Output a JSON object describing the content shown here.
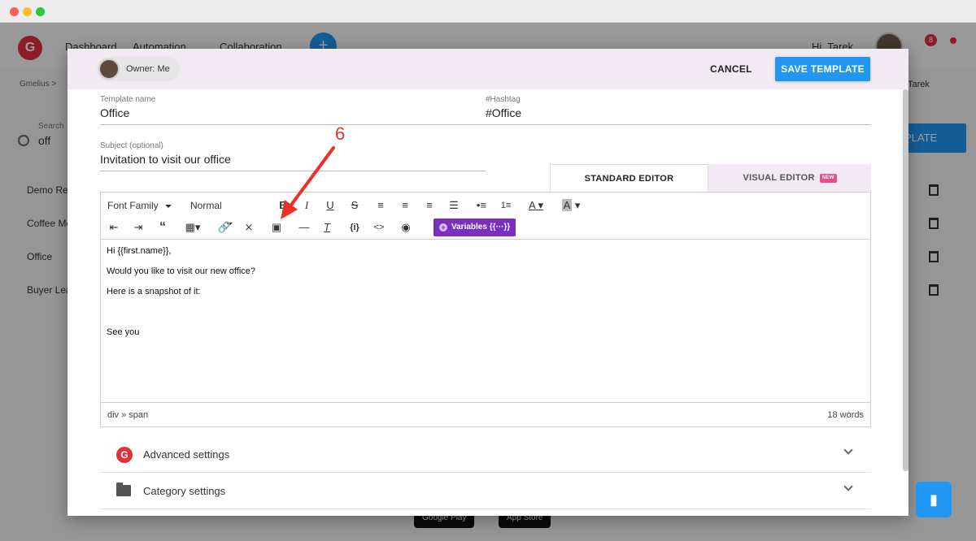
{
  "background": {
    "nav": [
      "Dashboard",
      "Automation",
      "Collaboration"
    ],
    "plus_label": "+",
    "greeting": "Hi, Tarek",
    "badge_count": "8",
    "breadcrumb": "Gmelius >",
    "user_label": "p, Tarek",
    "search_label": "Search",
    "search_value": "off",
    "create_label": "PLATE",
    "rows": [
      "Demo Rec",
      "Coffee Me",
      "Office",
      "Buyer Lea"
    ],
    "stores": [
      "Google Play",
      "App Store"
    ]
  },
  "modal": {
    "owner_label": "Owner: Me",
    "cancel_label": "CANCEL",
    "save_label": "SAVE TEMPLATE",
    "template_name": {
      "label": "Template name",
      "value": "Office"
    },
    "hashtag": {
      "label": "#Hashtag",
      "value": "#Office"
    },
    "subject": {
      "label": "Subject (optional)",
      "value": "Invitation to visit our office"
    },
    "tabs": {
      "standard": "STANDARD EDITOR",
      "visual": "VISUAL EDITOR",
      "new_badge": "NEW"
    },
    "toolbar": {
      "font_family": "Font Family",
      "font_size": "Normal",
      "variables": "Variables {{···}}"
    },
    "content": [
      "Hi {{first.name}},",
      "Would you like to visit our new office?",
      "Here is a snapshot of it:",
      "",
      "See you"
    ],
    "status_path": "div » span",
    "word_count": "18 words",
    "accordions": [
      "Advanced settings",
      "Category settings"
    ]
  },
  "annotation": {
    "number": "6",
    "color": "#e8312a"
  },
  "colors": {
    "primary": "#2196f3",
    "brand_red": "#e0313a",
    "variables_purple": "#7b2fbf"
  }
}
